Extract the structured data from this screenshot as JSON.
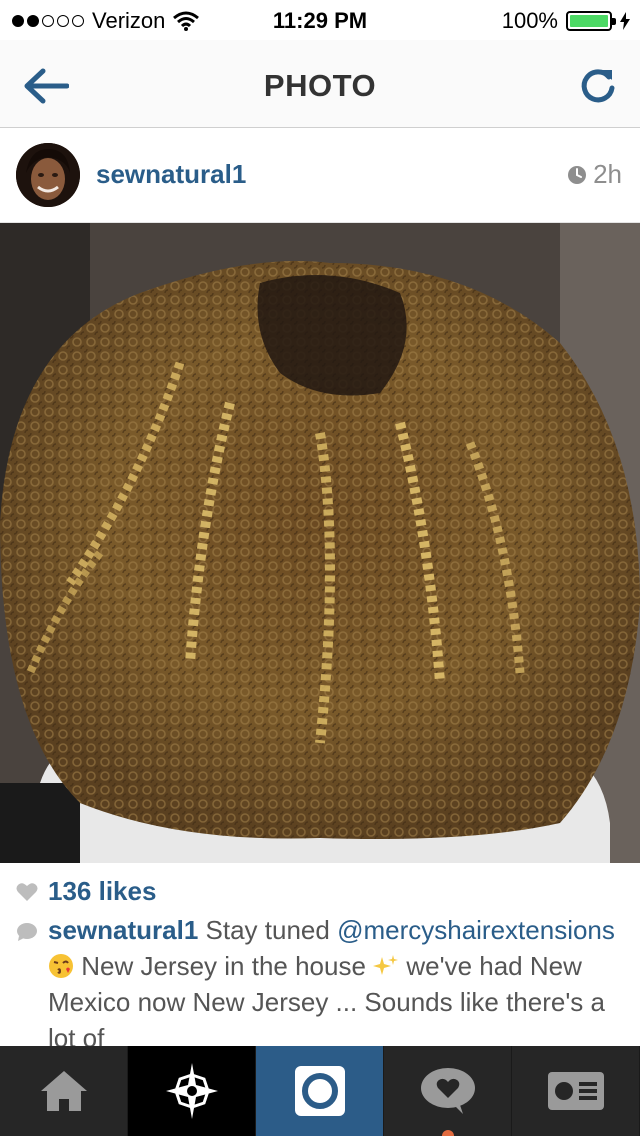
{
  "status_bar": {
    "carrier": "Verizon",
    "time": "11:29 PM",
    "battery_percent": "100%",
    "signal_strength": 2,
    "signal_total": 5,
    "battery_fill": 1.0,
    "battery_color": "#4cd964"
  },
  "nav": {
    "title": "PHOTO",
    "back_icon": "back-arrow-icon",
    "refresh_icon": "refresh-icon",
    "accent": "#2a5d89"
  },
  "post": {
    "username": "sewnatural1",
    "time_ago": "2h",
    "likes": "136 likes",
    "caption": {
      "author": "sewnatural1",
      "text_1": " Stay tuned ",
      "mention": "@mercyshairextensions",
      "text_2": " New Jersey in the house ",
      "text_3": " we've had New Mexico now New Jersey ... Sounds like there's a lot of"
    }
  },
  "tabs": [
    {
      "name": "home",
      "icon": "home-icon"
    },
    {
      "name": "explore",
      "icon": "explore-star-icon"
    },
    {
      "name": "camera",
      "icon": "camera-icon"
    },
    {
      "name": "activity",
      "icon": "heart-bubble-icon"
    },
    {
      "name": "profile",
      "icon": "profile-card-icon"
    }
  ]
}
